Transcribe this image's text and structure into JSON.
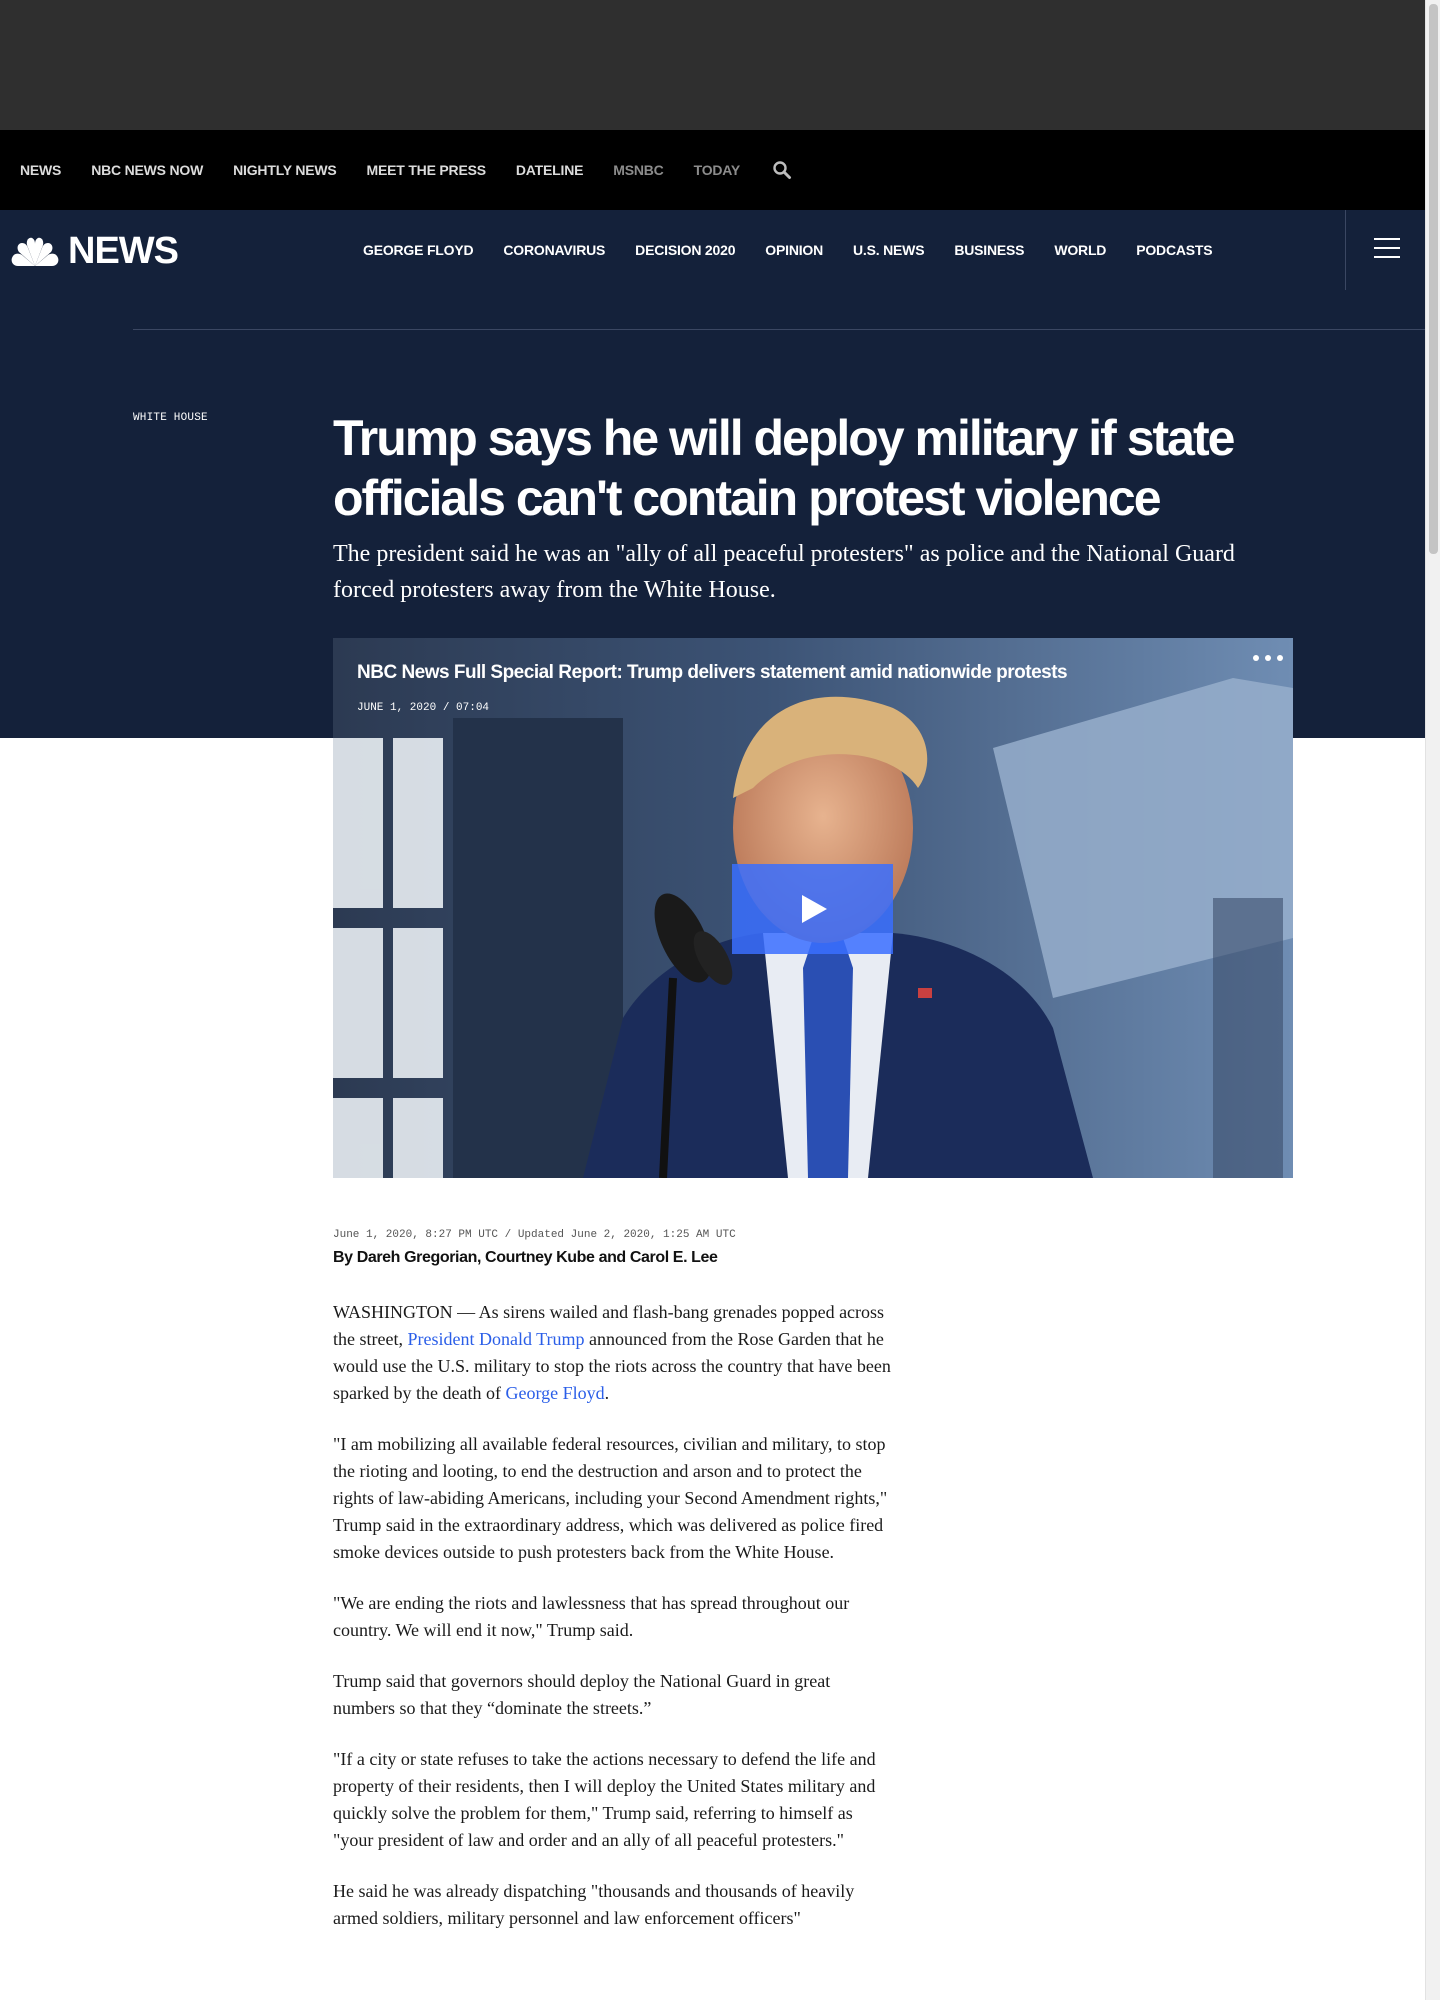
{
  "top_nav": {
    "items": [
      "NEWS",
      "NBC NEWS NOW",
      "NIGHTLY NEWS",
      "MEET THE PRESS",
      "DATELINE",
      "MSNBC",
      "TODAY"
    ]
  },
  "brand": {
    "logo_text": "NEWS"
  },
  "section_nav": {
    "items": [
      "GEORGE FLOYD",
      "CORONAVIRUS",
      "DECISION 2020",
      "OPINION",
      "U.S. NEWS",
      "BUSINESS",
      "WORLD",
      "PODCASTS"
    ]
  },
  "article": {
    "eyebrow": "WHITE HOUSE",
    "headline": "Trump says he will deploy military if state officials can't contain protest violence",
    "dek": "The president said he was an \"ally of all peaceful protesters\" as police and the National Guard forced protesters away from the White House.",
    "dates": "June 1, 2020, 8:27 PM UTC / Updated June 2, 2020, 1:25 AM UTC",
    "byline": "By Dareh Gregorian, Courtney Kube and Carol E. Lee"
  },
  "video": {
    "title": "NBC News Full Special Report: Trump delivers statement amid nationwide protests",
    "meta": "JUNE 1, 2020 / 07:04"
  },
  "body": {
    "p1_a": "WASHINGTON — As sirens wailed and flash-bang grenades popped across the street, ",
    "p1_link1": "President Donald Trump",
    "p1_b": " announced from the Rose Garden that he would use the U.S. military to stop the riots across the country that have been sparked by the death of ",
    "p1_link2": "George Floyd",
    "p1_c": ".",
    "p2": "\"I am mobilizing all available federal resources, civilian and military, to stop the rioting and looting, to end the destruction and arson and to protect the rights of law-abiding Americans, including your Second Amendment rights,\" Trump said in the extraordinary address, which was delivered as police fired smoke devices outside to push protesters back from the White House.",
    "p3": "\"We are ending the riots and lawlessness that has spread throughout our country. We will end it now,\" Trump said.",
    "p4": "Trump said that governors should deploy the National Guard in great numbers so that they “dominate the streets.”",
    "p5": "\"If a city or state refuses to take the actions necessary to defend the life and property of their residents, then I will deploy the United States military and quickly solve the problem for them,\" Trump said, referring to himself as \"your president of law and order and an ally of all peaceful protesters.\"",
    "p6": "He said he was already dispatching \"thousands and thousands of heavily armed soldiers, military personnel and law enforcement officers\""
  },
  "icons": {
    "search": "search-icon",
    "logo": "peacock-icon",
    "menu": "hamburger-menu-icon",
    "more": "more-options-icon",
    "play": "play-icon"
  },
  "colors": {
    "hero_bg": "#14213a",
    "top_nav_bg": "#000000",
    "ad_band_bg": "#2f2f2f",
    "play_button": "#3a6eff",
    "link": "#2a5ee8"
  }
}
